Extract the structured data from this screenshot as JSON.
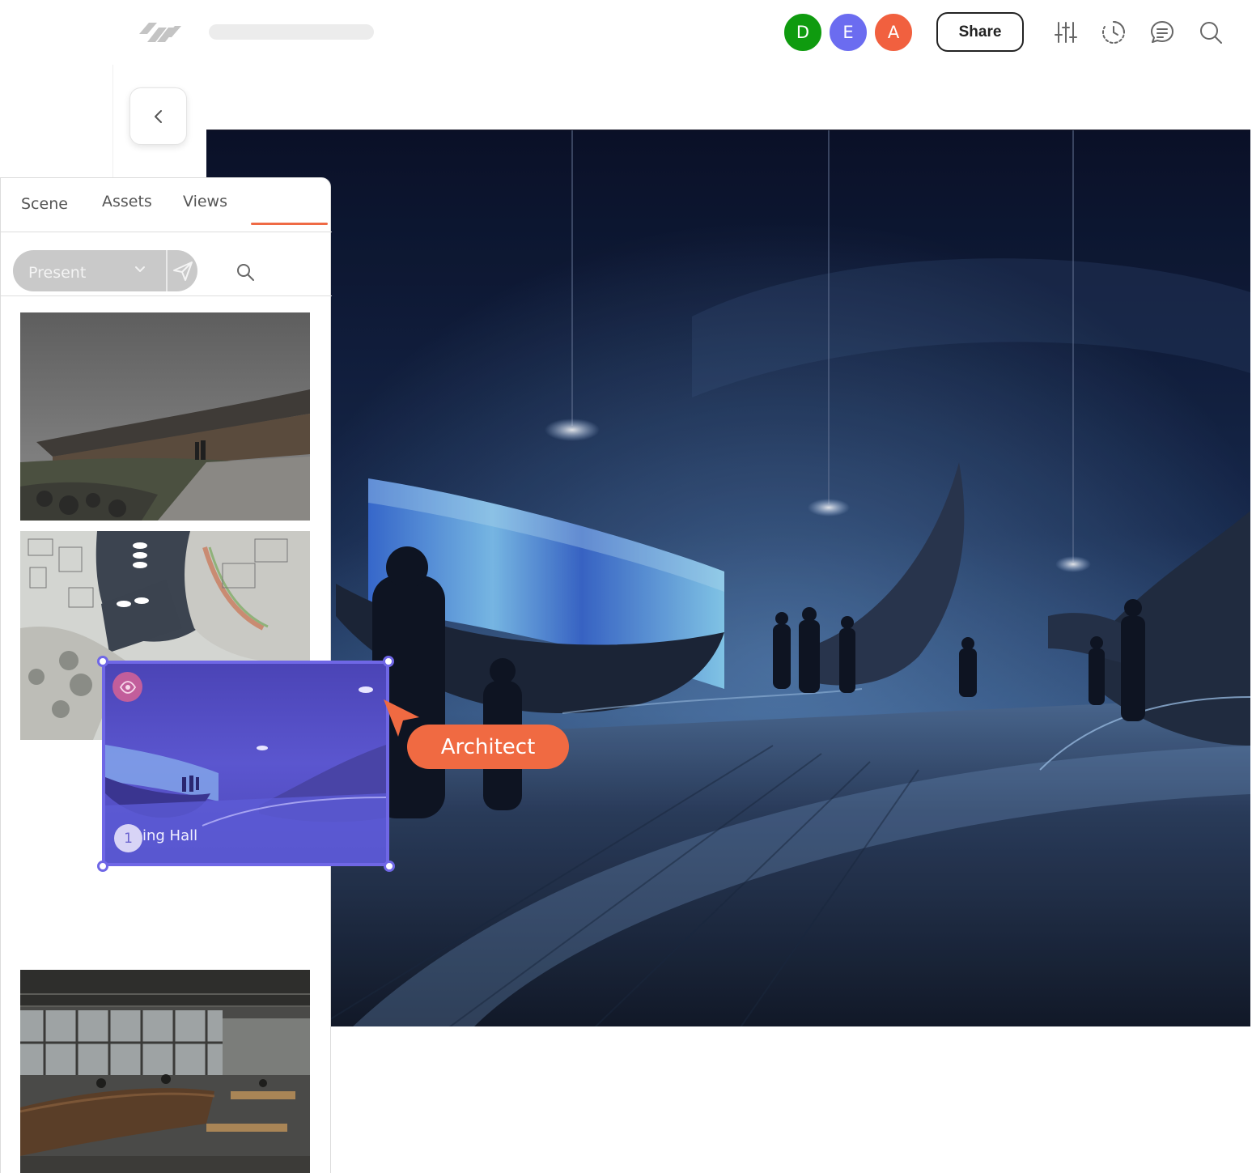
{
  "topbar": {
    "collaborators": [
      {
        "initial": "D",
        "color": "#0f9b0f"
      },
      {
        "initial": "E",
        "color": "#6b6cf0"
      },
      {
        "initial": "A",
        "color": "#f1603f"
      }
    ],
    "share_label": "Share",
    "icons": [
      "sliders-icon",
      "history-icon",
      "comment-icon",
      "search-icon"
    ]
  },
  "panel": {
    "tabs": [
      {
        "label": "Scene",
        "active": false
      },
      {
        "label": "Assets",
        "active": false
      },
      {
        "label": "Views",
        "active": true
      }
    ],
    "present_label": "Present",
    "views": [
      {
        "image": "exterior-building-rendering"
      },
      {
        "image": "site-plan-map"
      },
      {
        "image": "workshop-interior-rendering"
      }
    ]
  },
  "drag_card": {
    "number": "1",
    "name": "ing Hall",
    "image": "viking-hall-night-rendering"
  },
  "cursor": {
    "label": "Architect",
    "color": "#f06a42"
  },
  "colors": {
    "accent": "#ef6a45",
    "selection": "#6f67e6"
  }
}
